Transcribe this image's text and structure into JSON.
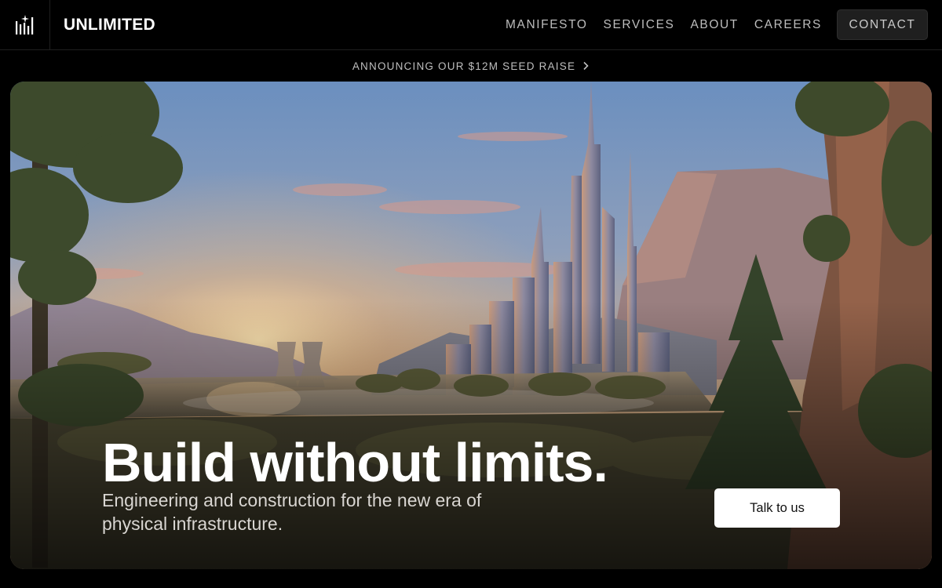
{
  "brand": {
    "name": "UNLIMITED",
    "logo_icon": "unlimited-bars-icon"
  },
  "nav": {
    "links": [
      "MANIFESTO",
      "SERVICES",
      "ABOUT",
      "CAREERS"
    ],
    "contact_label": "CONTACT"
  },
  "announcement": {
    "text": "ANNOUNCING OUR $12M SEED RAISE",
    "icon": "chevron-right-icon"
  },
  "hero": {
    "title": "Build without limits.",
    "subtitle": "Engineering and construction for the new era of physical infrastructure.",
    "cta_label": "Talk to us"
  },
  "colors": {
    "background": "#000000",
    "nav_text": "#bdbdbd",
    "contact_bg": "#1f1f1f",
    "cta_bg": "#ffffff"
  }
}
